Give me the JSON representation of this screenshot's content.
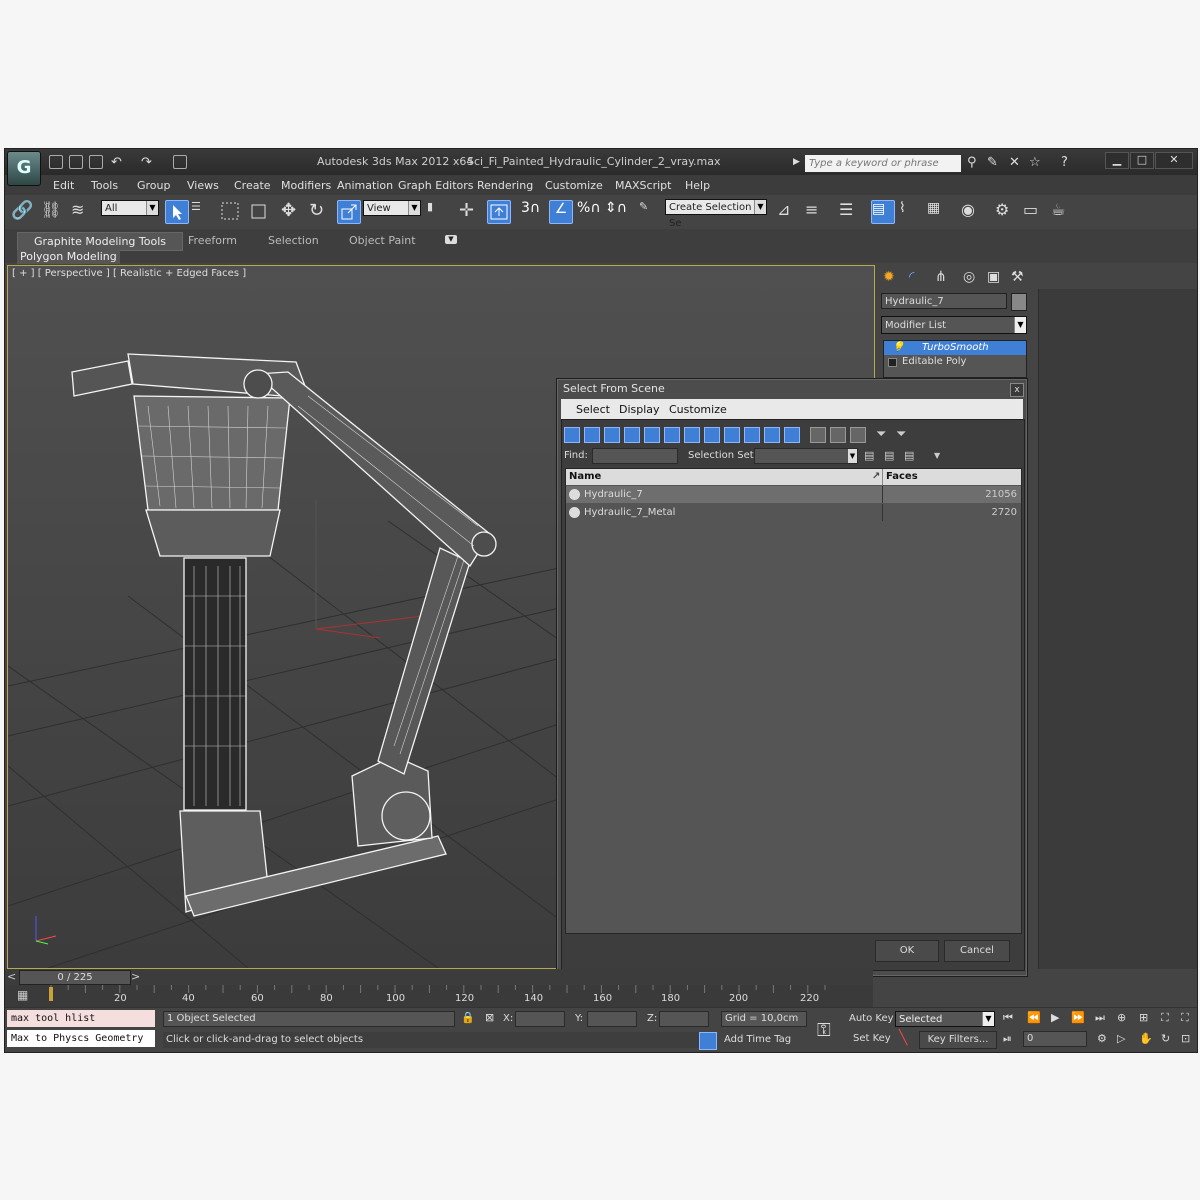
{
  "app": {
    "title": "Autodesk 3ds Max  2012 x64",
    "file": "Sci_Fi_Painted_Hydraulic_Cylinder_2_vray.max",
    "search_placeholder": "Type a keyword or phrase",
    "logo": "G"
  },
  "menu": [
    "Edit",
    "Tools",
    "Group",
    "Views",
    "Create",
    "Modifiers",
    "Animation",
    "Graph Editors",
    "Rendering",
    "Customize",
    "MAXScript",
    "Help"
  ],
  "toolbar": {
    "filter_value": "All",
    "refcoord_value": "View",
    "selection_set_placeholder": "Create Selection Se",
    "snap_3": "3",
    "snap_percent": "%"
  },
  "ribbon": {
    "tabs": [
      "Graphite Modeling Tools",
      "Freeform",
      "Selection",
      "Object Paint"
    ],
    "panel": "Polygon Modeling"
  },
  "viewport": {
    "label": "[ + ] [ Perspective ] [ Realistic + Edged Faces ]"
  },
  "command_panel": {
    "object_name": "Hydraulic_7",
    "modifier_list": "Modifier List",
    "stack": [
      "TurboSmooth",
      "Editable Poly"
    ]
  },
  "dialog": {
    "title": "Select From Scene",
    "close": "x",
    "menu": [
      "Select",
      "Display",
      "Customize"
    ],
    "find_label": "Find:",
    "selset_label": "Selection Set:",
    "columns": [
      "Name",
      "Faces"
    ],
    "rows": [
      {
        "name": "Hydraulic_7",
        "faces": "21056"
      },
      {
        "name": "Hydraulic_7_Metal",
        "faces": "2720"
      }
    ],
    "ok": "OK",
    "cancel": "Cancel"
  },
  "timeline": {
    "frame": "0 / 225",
    "ticks": [
      "20",
      "40",
      "60",
      "80",
      "100",
      "120",
      "140",
      "160",
      "180",
      "200",
      "220"
    ]
  },
  "status": {
    "listener_1": "max tool hlist",
    "listener_2": "Max to Physcs Geometry",
    "selection": "1 Object Selected",
    "prompt": "Click or click-and-drag to select objects",
    "x_label": "X:",
    "y_label": "Y:",
    "z_label": "Z:",
    "grid": "Grid = 10,0cm",
    "add_time_tag": "Add Time Tag",
    "auto_key": "Auto Key",
    "set_key": "Set Key",
    "selected": "Selected",
    "key_filters": "Key Filters...",
    "current_frame": "0"
  },
  "colors": {
    "accent": "#3f7fd6",
    "viewport_border": "#b9a84c",
    "wire": "#ffffff"
  }
}
